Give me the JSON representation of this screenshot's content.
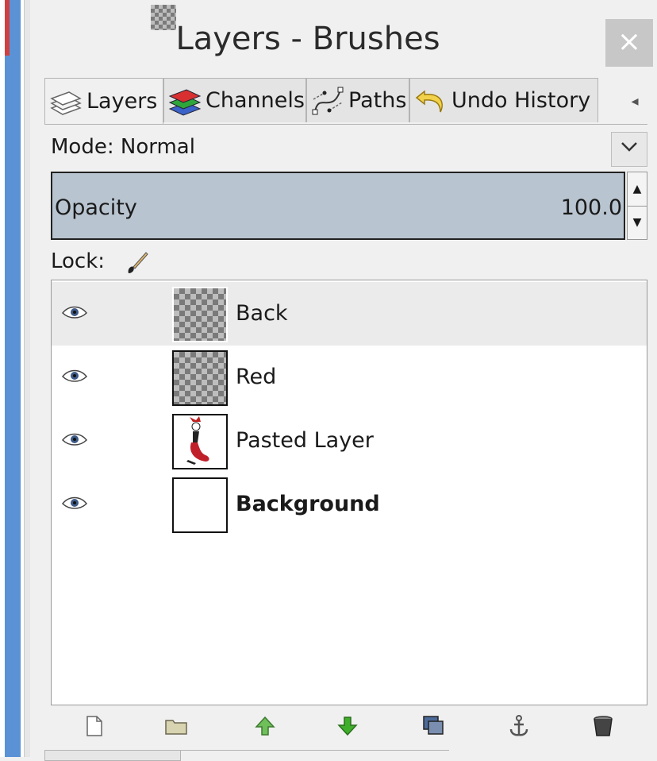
{
  "window": {
    "title": "Layers - Brushes",
    "close_label": "×"
  },
  "tabs": [
    {
      "label": "Layers",
      "icon": "layers-icon",
      "active": true
    },
    {
      "label": "Channels",
      "icon": "channels-icon",
      "active": false
    },
    {
      "label": "Paths",
      "icon": "paths-icon",
      "active": false
    },
    {
      "label": "Undo History",
      "icon": "undo-history-icon",
      "active": false
    }
  ],
  "tab_menu_icon": "tab-menu-arrow-icon",
  "mode": {
    "label": "Mode: Normal"
  },
  "opacity": {
    "label": "Opacity",
    "value": "100.0"
  },
  "lock": {
    "label": "Lock:"
  },
  "layers": [
    {
      "name": "Back",
      "selected": true,
      "visible": true,
      "thumb": "transparent"
    },
    {
      "name": "Red",
      "selected": false,
      "visible": true,
      "thumb": "transparent"
    },
    {
      "name": "Pasted Layer",
      "selected": false,
      "visible": true,
      "thumb": "figure"
    },
    {
      "name": "Background",
      "selected": false,
      "visible": true,
      "thumb": "white",
      "bold": true
    }
  ],
  "bottom_buttons": [
    {
      "icon": "new-layer-icon"
    },
    {
      "icon": "new-layer-group-icon"
    },
    {
      "icon": "raise-layer-icon"
    },
    {
      "icon": "lower-layer-icon"
    },
    {
      "icon": "duplicate-layer-icon"
    },
    {
      "icon": "anchor-layer-icon"
    },
    {
      "icon": "delete-layer-icon"
    }
  ],
  "colors": {
    "opacity_bg": "#b8c4d0",
    "selected_row": "#ebebeb",
    "raise_arrow": "#6fbf5a",
    "lower_arrow": "#3fae2a"
  }
}
